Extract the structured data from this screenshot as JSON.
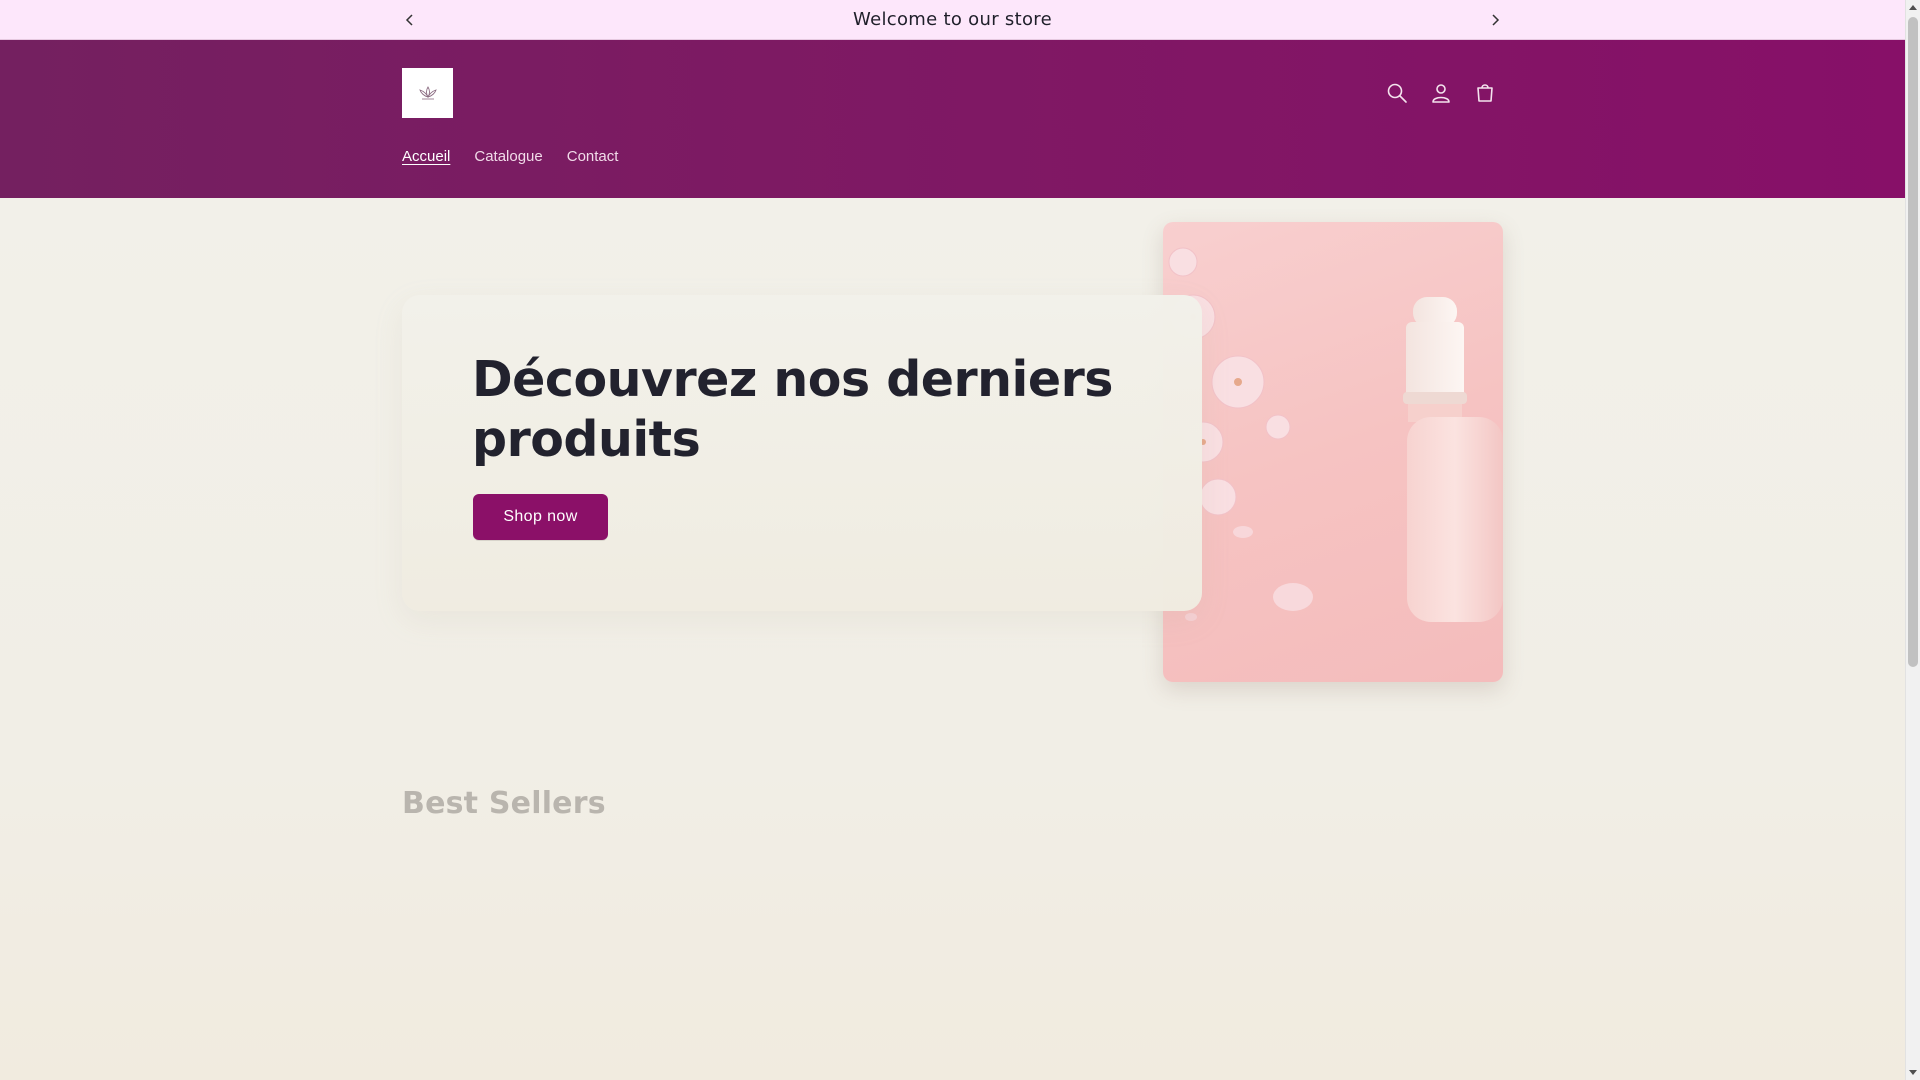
{
  "announcement": {
    "text": "Welcome to our store"
  },
  "header": {
    "logo_icon": "lotus-logo-icon",
    "icons": [
      "search-icon",
      "account-icon",
      "cart-icon"
    ]
  },
  "nav": {
    "items": [
      {
        "label": "Accueil",
        "active": true
      },
      {
        "label": "Catalogue",
        "active": false
      },
      {
        "label": "Contact",
        "active": false
      }
    ]
  },
  "hero": {
    "title": "Découvrez nos derniers produits",
    "button_label": "Shop now",
    "image_icon": "serum-bottle-image"
  },
  "sections": {
    "best_sellers_title": "Best Sellers"
  },
  "colors": {
    "announcement_bg": "#fde7fb",
    "header_bg": "#7d1a63",
    "accent": "#8b1068",
    "page_bg": "#f2f1ea"
  }
}
